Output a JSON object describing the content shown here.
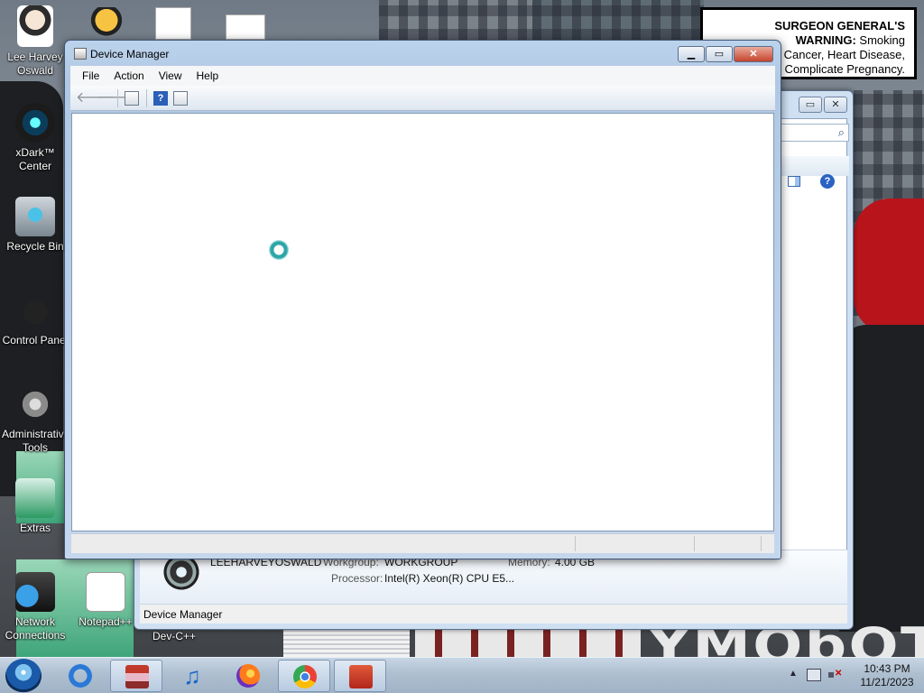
{
  "desktop": {
    "icons": [
      {
        "label": "Lee Harvey Oswald",
        "icon": "user-icon"
      },
      {
        "label": "xDark™ Center",
        "icon": "xdark-icon"
      },
      {
        "label": "Recycle Bin",
        "icon": "recycle-bin-icon"
      },
      {
        "label": "Control Panel",
        "icon": "control-panel-icon"
      },
      {
        "label": "Administrative Tools",
        "icon": "admin-tools-icon"
      },
      {
        "label": "Extras",
        "icon": "extras-icon"
      },
      {
        "label": "Network Connections",
        "icon": "network-icon"
      },
      {
        "label": "Notepad++",
        "icon": "notepad-icon"
      },
      {
        "label": "Dev-C++",
        "icon": "devcpp-icon"
      }
    ],
    "warning": {
      "heading": "SURGEON GENERAL'S WARNING:",
      "line1": "Smoking",
      "line2": "Cancer, Heart Disease,",
      "line3": "d May Complicate Pregnancy."
    },
    "watermark": "YMObOT"
  },
  "device_manager": {
    "title": "Device Manager",
    "controls": {
      "minimize": "▁",
      "maximize": "▭",
      "close": "✕"
    },
    "menu": [
      "File",
      "Action",
      "View",
      "Help"
    ],
    "toolbar": {
      "back": "🡐",
      "forward": "🡒",
      "help": "?"
    }
  },
  "computer_window": {
    "computer_name": "LEEHARVEYOSWALD",
    "workgroup_label": "Workgroup:",
    "workgroup_value": "WORKGROUP",
    "memory_label": "Memory:",
    "memory_value": "4.00 GB",
    "processor_label": "Processor:",
    "processor_value": "Intel(R) Xeon(R) CPU E5...",
    "status_text": "Device Manager",
    "search_icon": "⌕",
    "controls": {
      "maximize": "▭",
      "close": "✕"
    }
  },
  "taskbar": {
    "items": [
      "windows-explorer-archive",
      "internet-explorer",
      "itunes",
      "firefox",
      "chrome",
      "toolbox"
    ],
    "music_glyph": "♫",
    "clock_time": "10:43 PM",
    "clock_date": "11/21/2023",
    "tray_arrow": "▲"
  }
}
